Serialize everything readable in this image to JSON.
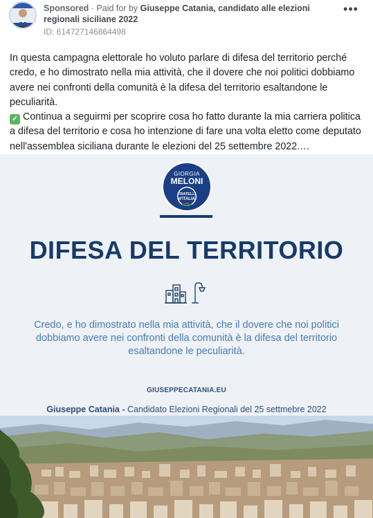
{
  "ad": {
    "sponsored_label": "Sponsored",
    "paid_prefix": " · Paid for by ",
    "payer": "Giuseppe Catania, candidato alle elezioni regionali siciliane 2022",
    "ad_id": "ID: 614727146864498",
    "more_icon": "more-horizontal-icon"
  },
  "post": {
    "paragraph1": "In questa campagna elettorale ho voluto parlare di difesa del territorio perché credo, e ho dimostrato nella mia attività, che il dovere che noi politici dobbiamo avere nei confronti della comunità è la difesa del territorio esaltandone le peculiarità.",
    "paragraph2": "Continua a seguirmi per scoprire cosa ho fatto durante la mia carriera politica a difesa del territorio e cosa ho intenzione di fare una volta eletto come deputato nell'assemblea siciliana durante le elezioni del 25 settembre 2022.…",
    "check_icon": "check-mark-icon"
  },
  "creative": {
    "logo": {
      "line1": "GIORGIA",
      "line2": "MELONI",
      "line3": "FRATELLI",
      "line4": "d'ITALIA"
    },
    "title": "DIFESA DEL TERRITORIO",
    "quote": "Credo, e ho dimostrato nella mia attività, che il dovere che noi politici dobbiamo avere nei confronti della comunità è la difesa del territorio esaltandone le peculiarità.",
    "website": "GIUSEPPECATANIA.EU",
    "candidate_name": "Giuseppe Catania -",
    "candidate_role": " Candidato Elezioni Regionali del 25 settmebre 2022",
    "colors": {
      "navy": "#163a6a",
      "quote_blue": "#4a79b0",
      "background": "#eef2f7"
    }
  }
}
